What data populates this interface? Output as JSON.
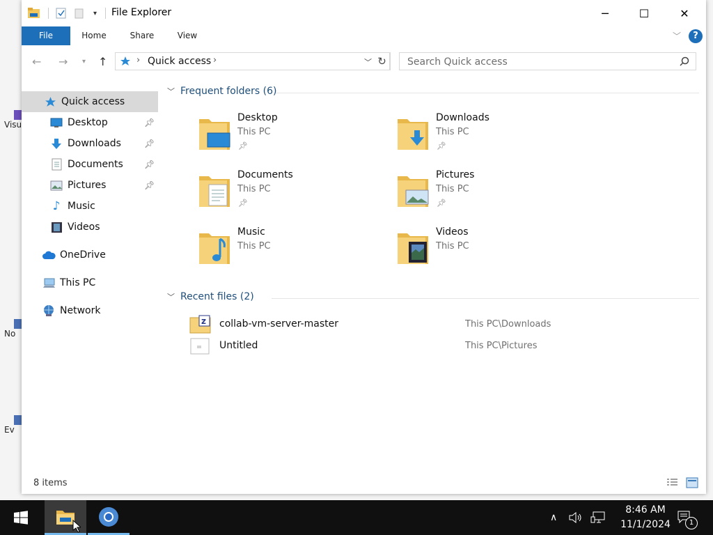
{
  "window": {
    "title": "File Explorer",
    "minimize_glyph": "─",
    "maximize_glyph": "☐",
    "close_glyph": "✕"
  },
  "ribbon": {
    "tabs": [
      "File",
      "Home",
      "Share",
      "View"
    ],
    "help_glyph": "?"
  },
  "address": {
    "crumb": "Quick access",
    "search_placeholder": "Search Quick access"
  },
  "nav": {
    "items": [
      {
        "label": "Quick access",
        "icon": "star-icon"
      },
      {
        "label": "Desktop",
        "icon": "desktop-icon",
        "pinned": true
      },
      {
        "label": "Downloads",
        "icon": "download-arrow-icon",
        "pinned": true
      },
      {
        "label": "Documents",
        "icon": "document-icon",
        "pinned": true
      },
      {
        "label": "Pictures",
        "icon": "picture-icon",
        "pinned": true
      },
      {
        "label": "Music",
        "icon": "music-note-icon"
      },
      {
        "label": "Videos",
        "icon": "film-icon"
      },
      {
        "label": "OneDrive",
        "icon": "cloud-icon"
      },
      {
        "label": "This PC",
        "icon": "computer-icon"
      },
      {
        "label": "Network",
        "icon": "network-icon"
      }
    ]
  },
  "frequent": {
    "header": "Frequent folders (6)",
    "items": [
      {
        "name": "Desktop",
        "location": "This PC",
        "pinned": true
      },
      {
        "name": "Downloads",
        "location": "This PC",
        "pinned": true
      },
      {
        "name": "Documents",
        "location": "This PC",
        "pinned": true
      },
      {
        "name": "Pictures",
        "location": "This PC",
        "pinned": true
      },
      {
        "name": "Music",
        "location": "This PC"
      },
      {
        "name": "Videos",
        "location": "This PC"
      }
    ]
  },
  "recent": {
    "header": "Recent files (2)",
    "items": [
      {
        "name": "collab-vm-server-master",
        "path": "This PC\\Downloads"
      },
      {
        "name": "Untitled",
        "path": "This PC\\Pictures"
      }
    ]
  },
  "status": {
    "count": "8 items"
  },
  "taskbar": {
    "time": "8:46 AM",
    "date": "11/1/2024",
    "notification_count": "1"
  },
  "desktop_icons": [
    "Visu",
    "No",
    "Ev"
  ],
  "colors": {
    "accent": "#1e6fba",
    "folder": "#f2c75c",
    "selected_nav": "#d9d9d9"
  }
}
